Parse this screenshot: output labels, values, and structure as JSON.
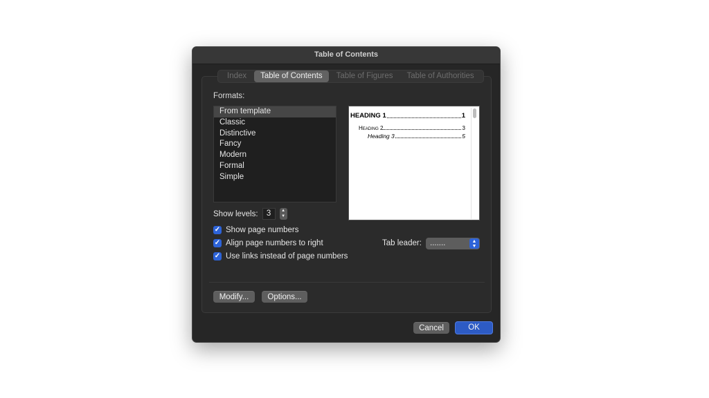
{
  "dialog": {
    "title": "Table of Contents"
  },
  "tabs": [
    {
      "label": "Index",
      "active": false
    },
    {
      "label": "Table of Contents",
      "active": true
    },
    {
      "label": "Table of Figures",
      "active": false
    },
    {
      "label": "Table of Authorities",
      "active": false
    }
  ],
  "formats": {
    "label": "Formats:",
    "items": [
      "From template",
      "Classic",
      "Distinctive",
      "Fancy",
      "Modern",
      "Formal",
      "Simple"
    ],
    "selected": "From template"
  },
  "preview": {
    "rows": [
      {
        "text": "HEADING 1",
        "page": "1"
      },
      {
        "text": "Heading 2",
        "page": "3"
      },
      {
        "text": "Heading 3",
        "page": "5"
      }
    ]
  },
  "levels": {
    "label": "Show levels:",
    "value": "3"
  },
  "options": {
    "show_page_numbers": {
      "label": "Show page numbers",
      "checked": true
    },
    "align_right": {
      "label": "Align page numbers to right",
      "checked": true
    },
    "use_links": {
      "label": "Use links instead of page numbers",
      "checked": true
    }
  },
  "tab_leader": {
    "label": "Tab leader:",
    "value": "......."
  },
  "buttons": {
    "modify": "Modify...",
    "options": "Options...",
    "cancel": "Cancel",
    "ok": "OK"
  },
  "colors": {
    "accent": "#2d63d8",
    "dialog_bg": "#262626"
  },
  "icons": {
    "checkbox": "checkmark-icon",
    "stepper": "up-down-chevron-icon",
    "select": "up-down-chevron-icon"
  }
}
